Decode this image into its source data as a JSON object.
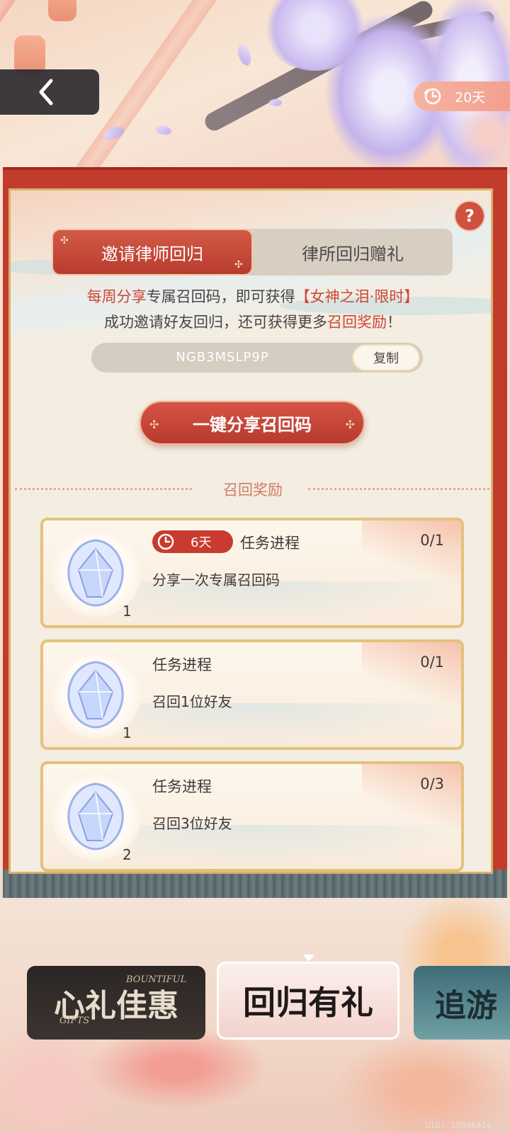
{
  "header": {
    "timer_text": "20天"
  },
  "tabs": [
    {
      "label": "邀请律师回归",
      "active": true
    },
    {
      "label": "律所回归赠礼",
      "active": false
    }
  ],
  "help_label": "?",
  "description": {
    "line1_part1": "每周分享",
    "line1_part2": "专属召回码，即可获得",
    "line1_part3": "【女神之泪·限时】",
    "line2_part1": "成功邀请好友回归，还可获得更多",
    "line2_part2": "召回奖励",
    "line2_part3": "！"
  },
  "recall_code": {
    "code": "NGB3MSLP9P",
    "copy_label": "复制"
  },
  "share_button_label": "一键分享召回码",
  "rewards_section_title": "召回奖励",
  "tasks": [
    {
      "badge": "6天",
      "label": "任务进程",
      "progress": "0/1",
      "description": "分享一次专属召回码",
      "reward_count": "1"
    },
    {
      "label": "任务进程",
      "progress": "0/1",
      "description": "召回1位好友",
      "reward_count": "1"
    },
    {
      "label": "任务进程",
      "progress": "0/3",
      "description": "召回3位好友",
      "reward_count": "2"
    }
  ],
  "carousel": [
    {
      "title": "心礼佳惠",
      "subtitle_top": "BOUNTIFUL",
      "subtitle_bottom": "GIFTS"
    },
    {
      "title": "回归有礼",
      "selected": true
    },
    {
      "title": "追游"
    }
  ],
  "uid_text": "UID: 10946414",
  "colors": {
    "accent_red": "#c93a2f",
    "highlight_text": "#cf4532",
    "gold_border": "#e3c27c",
    "panel_bg": "#f3ede2"
  },
  "icons": [
    "back-arrow-icon",
    "clock-icon",
    "help-icon",
    "gem-icon",
    "flower-icon"
  ]
}
